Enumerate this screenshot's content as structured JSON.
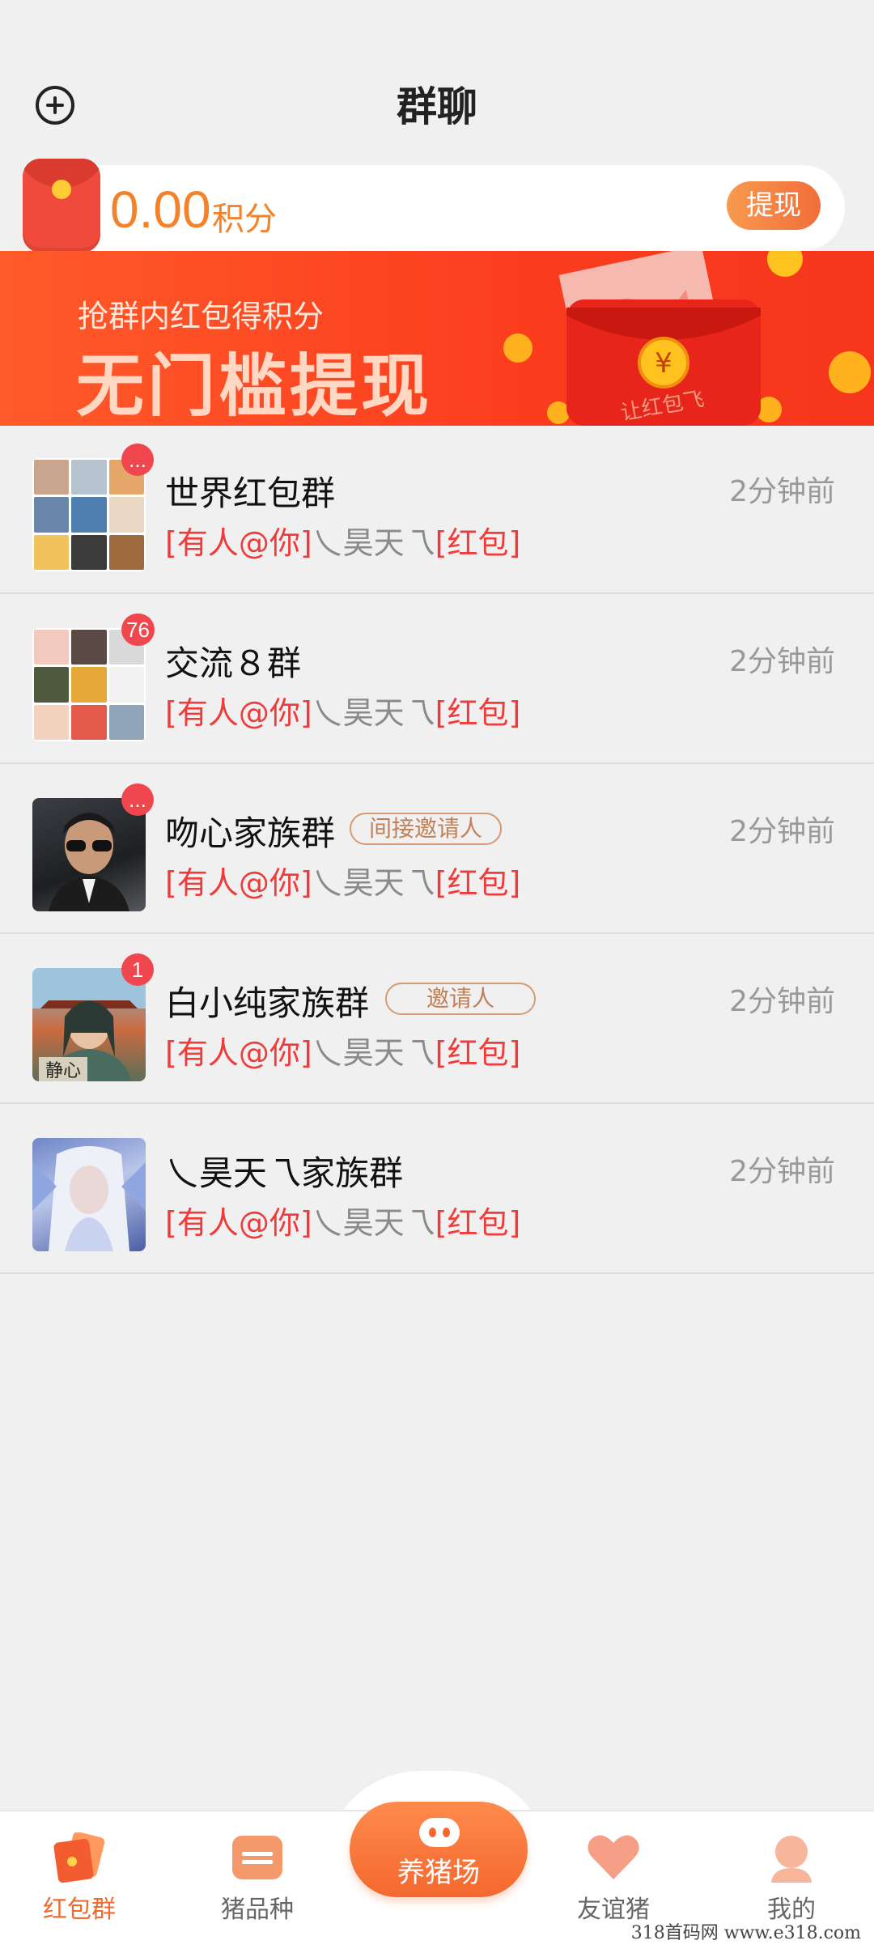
{
  "header": {
    "title": "群聊"
  },
  "points": {
    "value": "0.00",
    "unit": "积分",
    "withdraw_label": "提现"
  },
  "banner": {
    "subtitle": "抢群内红包得积分",
    "headline": "无门槛提现",
    "art_text": "让红包飞"
  },
  "groups": [
    {
      "name": "世界红包群",
      "tag": "",
      "time": "2分钟前",
      "badge": "...",
      "msg_prefix": "[有人@你]",
      "msg_sender": "乀昊天乁",
      "msg_content": "[红包]"
    },
    {
      "name": "交流８群",
      "tag": "",
      "time": "2分钟前",
      "badge": "76",
      "msg_prefix": "[有人@你]",
      "msg_sender": "乀昊天乁",
      "msg_content": "[红包]"
    },
    {
      "name": "吻心家族群",
      "tag": "间接邀请人",
      "time": "2分钟前",
      "badge": "...",
      "msg_prefix": "[有人@你]",
      "msg_sender": "乀昊天乁",
      "msg_content": "[红包]"
    },
    {
      "name": "白小纯家族群",
      "tag": "邀请人",
      "time": "2分钟前",
      "badge": "1",
      "msg_prefix": "[有人@你]",
      "msg_sender": "乀昊天乁",
      "msg_content": "[红包]"
    },
    {
      "name": "乀昊天乁家族群",
      "tag": "",
      "time": "2分钟前",
      "badge": "",
      "msg_prefix": "[有人@你]",
      "msg_sender": "乀昊天乁",
      "msg_content": "[红包]"
    }
  ],
  "nav": {
    "items": [
      {
        "label": "红包群",
        "icon": "red-packet-icon"
      },
      {
        "label": "猪品种",
        "icon": "pig-breed-icon"
      },
      {
        "label": "养猪场",
        "icon": "pig-face-icon"
      },
      {
        "label": "友谊猪",
        "icon": "heart-icon"
      },
      {
        "label": "我的",
        "icon": "profile-icon"
      }
    ]
  },
  "watermark": "318首码网  www.e318.com",
  "colors": {
    "accent": "#f4822a",
    "banner_red": "#fb3d1e",
    "message_red": "#ee3b3b",
    "badge_red": "#f0464e"
  }
}
